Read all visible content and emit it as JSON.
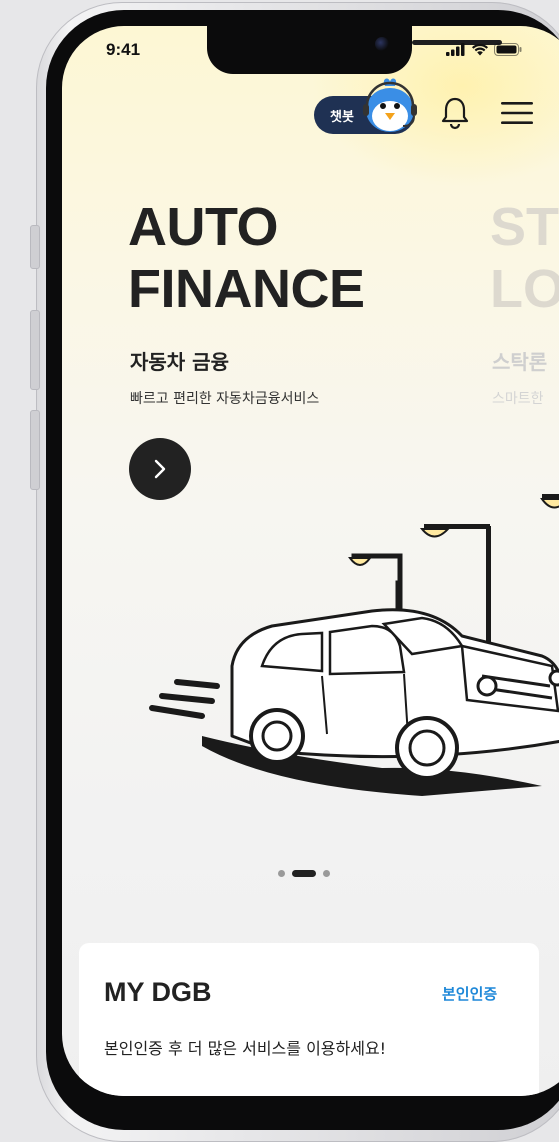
{
  "status_bar": {
    "time": "9:41"
  },
  "header": {
    "chatbot_label": "챗봇",
    "icons": [
      "chatbot-mascot-icon",
      "bell-icon",
      "menu-icon"
    ]
  },
  "carousel": {
    "slides": [
      {
        "title_line1": "AUTO",
        "title_line2": "FINANCE",
        "subtitle": "자동차 금융",
        "description": "빠르고 편리한 자동차금융서비스"
      },
      {
        "title_line1": "ST",
        "title_line2": "LO",
        "subtitle": "스탁론",
        "description": "스마트한"
      }
    ],
    "page_count": 3,
    "active_page": 2
  },
  "my_dgb": {
    "title": "MY DGB",
    "link_label": "본인인증",
    "description": "본인인증 후 더 많은 서비스를 이용하세요!"
  },
  "colors": {
    "accent_navy": "#1f3153",
    "link_blue": "#1e88d8",
    "text_dark": "#222222"
  }
}
